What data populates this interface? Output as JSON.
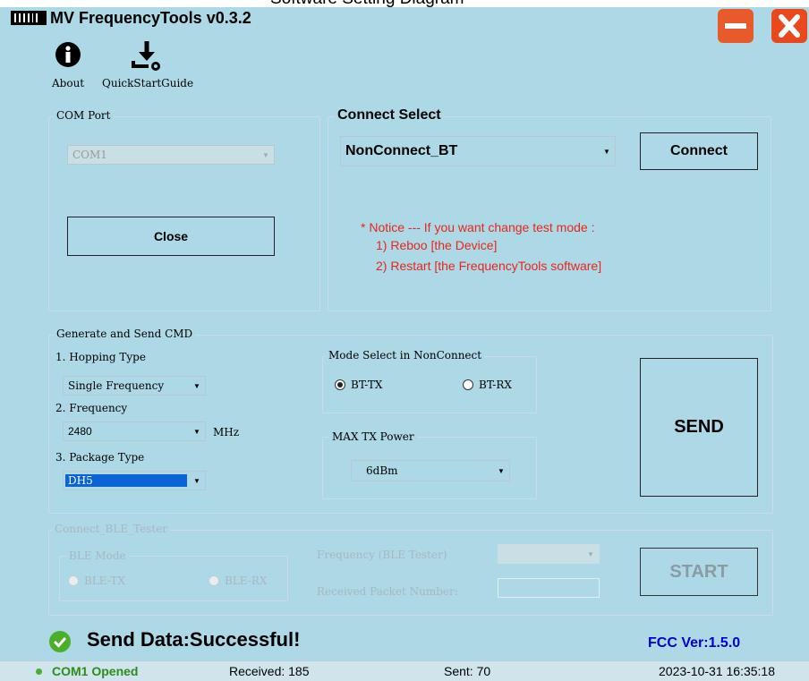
{
  "window": {
    "caption_overlay": "Software Setting Diagram",
    "title": "MV FrequencyTools v0.3.2"
  },
  "toolbar": {
    "about_label": "About",
    "quick_start_label": "QuickStartGuide"
  },
  "com_port": {
    "group_label": "COM Port",
    "selected": "COM1",
    "close_label": "Close"
  },
  "connect": {
    "group_label": "Connect Select",
    "selected": "NonConnect_BT",
    "connect_label": "Connect",
    "notice_lines": [
      "* Notice --- If you want change test mode :",
      "1) Reboo [the Device]",
      "2) Restart [the FrequencyTools software]"
    ]
  },
  "generate": {
    "group_label": "Generate and Send CMD",
    "hopping_label": "1. Hopping Type",
    "hopping_value": "Single Frequency",
    "frequency_label": "2. Frequency",
    "frequency_value": "2480",
    "frequency_unit": "MHz",
    "package_label": "3. Package Type",
    "package_value": "DH5",
    "mode_group_label": "Mode Select in NonConnect",
    "mode_tx": "BT-TX",
    "mode_rx": "BT-RX",
    "power_group_label": "MAX TX Power",
    "power_value": "6dBm",
    "send_label": "SEND"
  },
  "ble": {
    "group_label": "Connect_BLE_Tester",
    "mode_group_label": "BLE Mode",
    "tx": "BLE-TX",
    "rx": "BLE-RX",
    "freq_label": "Frequency (BLE Tester)",
    "packet_label": "Received Packet Number:",
    "start_label": "START"
  },
  "status_msg": "Send Data:Successful!",
  "fcc_ver": "FCC Ver:1.5.0",
  "statusbar": {
    "com": "COM1 Opened",
    "received": "Received: 185",
    "sent": "Sent: 70",
    "datetime": "2023-10-31 16:35:18"
  },
  "colors": {
    "background": "#add8e6",
    "notice": "#e8261c",
    "success": "#4caf2a",
    "fcc": "#0000cc",
    "minimize": "#e85a2a",
    "close": "#e8481c"
  }
}
